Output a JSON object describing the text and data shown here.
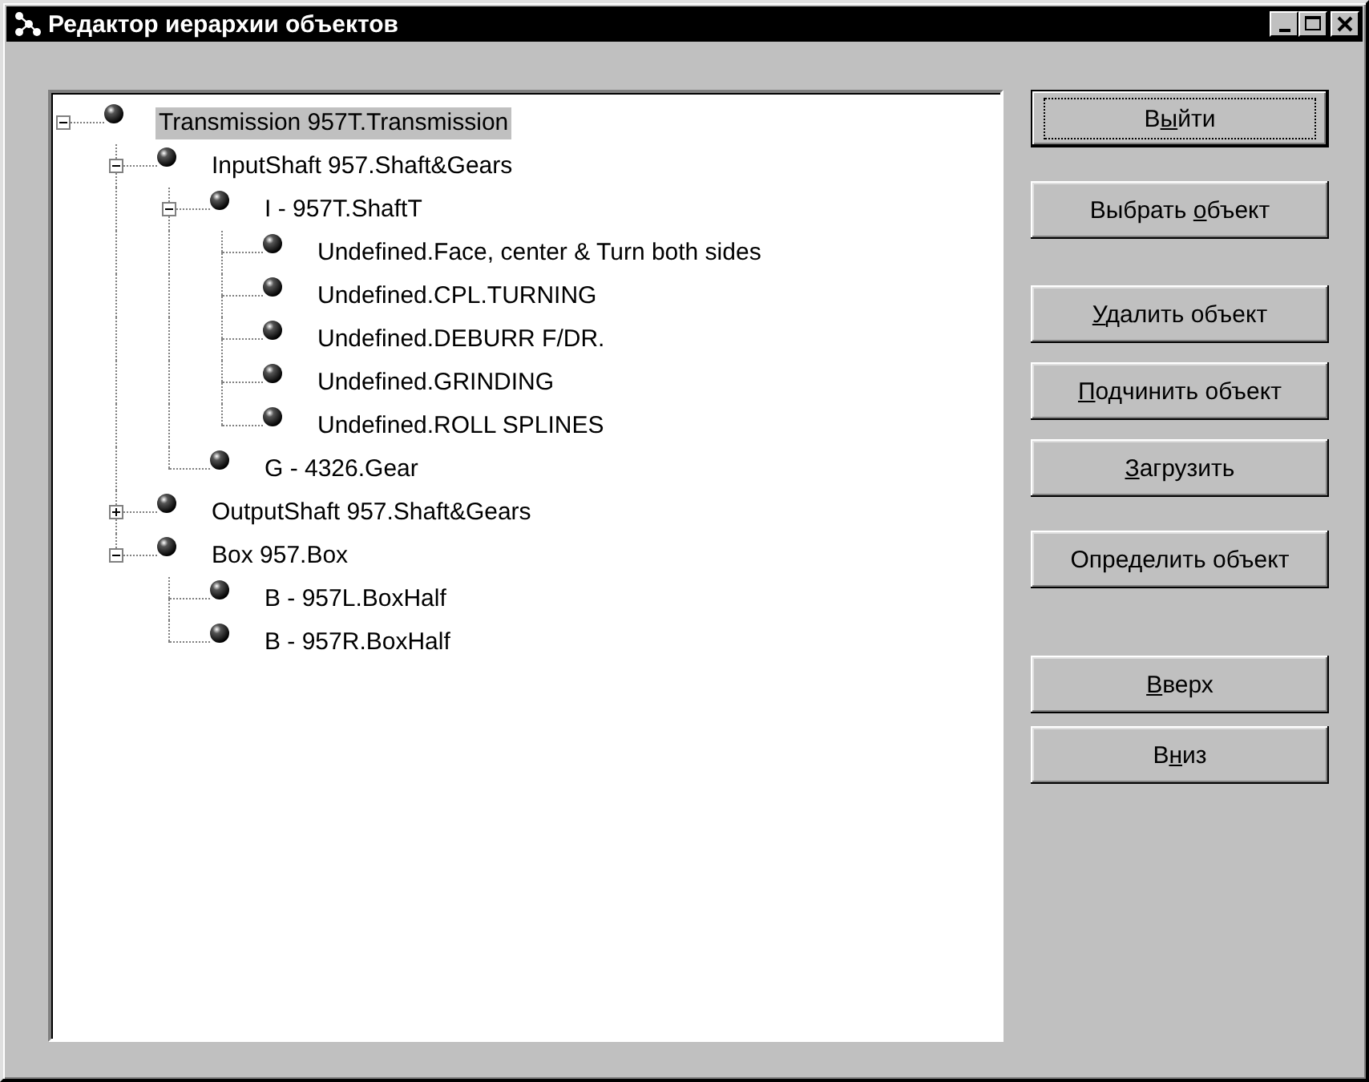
{
  "window": {
    "title": "Редактор иерархии объектов"
  },
  "tree": [
    {
      "label": "Transmission 957T.Transmission",
      "selected": true,
      "expanded": true,
      "children": [
        {
          "label": "InputShaft 957.Shaft&Gears",
          "selected": false,
          "expanded": true,
          "children": [
            {
              "label": "I - 957T.ShaftT",
              "selected": false,
              "expanded": true,
              "children": [
                {
                  "label": "Undefined.Face, center & Turn both sides",
                  "selected": false
                },
                {
                  "label": "Undefined.CPL.TURNING",
                  "selected": false
                },
                {
                  "label": "Undefined.DEBURR F/DR.",
                  "selected": false
                },
                {
                  "label": "Undefined.GRINDING",
                  "selected": false
                },
                {
                  "label": "Undefined.ROLL SPLINES",
                  "selected": false
                }
              ]
            },
            {
              "label": "G - 4326.Gear",
              "selected": false
            }
          ]
        },
        {
          "label": "OutputShaft 957.Shaft&Gears",
          "selected": false,
          "expanded": false
        },
        {
          "label": "Box 957.Box",
          "selected": false,
          "expanded": true,
          "children": [
            {
              "label": "B - 957L.BoxHalf",
              "selected": false
            },
            {
              "label": "B - 957R.BoxHalf",
              "selected": false
            }
          ]
        }
      ]
    }
  ],
  "buttons": [
    {
      "focused": true,
      "label": [
        {
          "text": "В",
          "underlined": false
        },
        {
          "text": "ы",
          "underlined": true
        },
        {
          "text": "йти",
          "underlined": false
        }
      ]
    },
    {
      "focused": false,
      "label": [
        {
          "text": "Выбрать ",
          "underlined": false
        },
        {
          "text": "о",
          "underlined": true
        },
        {
          "text": "бъект",
          "underlined": false
        }
      ]
    },
    {
      "focused": false,
      "label": [
        {
          "text": "У",
          "underlined": true
        },
        {
          "text": "далить объект",
          "underlined": false
        }
      ]
    },
    {
      "focused": false,
      "label": [
        {
          "text": "П",
          "underlined": true
        },
        {
          "text": "одчинить объект",
          "underlined": false
        }
      ]
    },
    {
      "focused": false,
      "label": [
        {
          "text": "З",
          "underlined": true
        },
        {
          "text": "агрузить",
          "underlined": false
        }
      ]
    },
    {
      "focused": false,
      "label": [
        {
          "text": "Определить объект",
          "underlined": false
        }
      ]
    },
    {
      "focused": false,
      "label": [
        {
          "text": "В",
          "underlined": true
        },
        {
          "text": "верх",
          "underlined": false
        }
      ]
    },
    {
      "focused": false,
      "label": [
        {
          "text": "В",
          "underlined": false
        },
        {
          "text": "н",
          "underlined": true
        },
        {
          "text": "из",
          "underlined": false
        }
      ]
    }
  ]
}
